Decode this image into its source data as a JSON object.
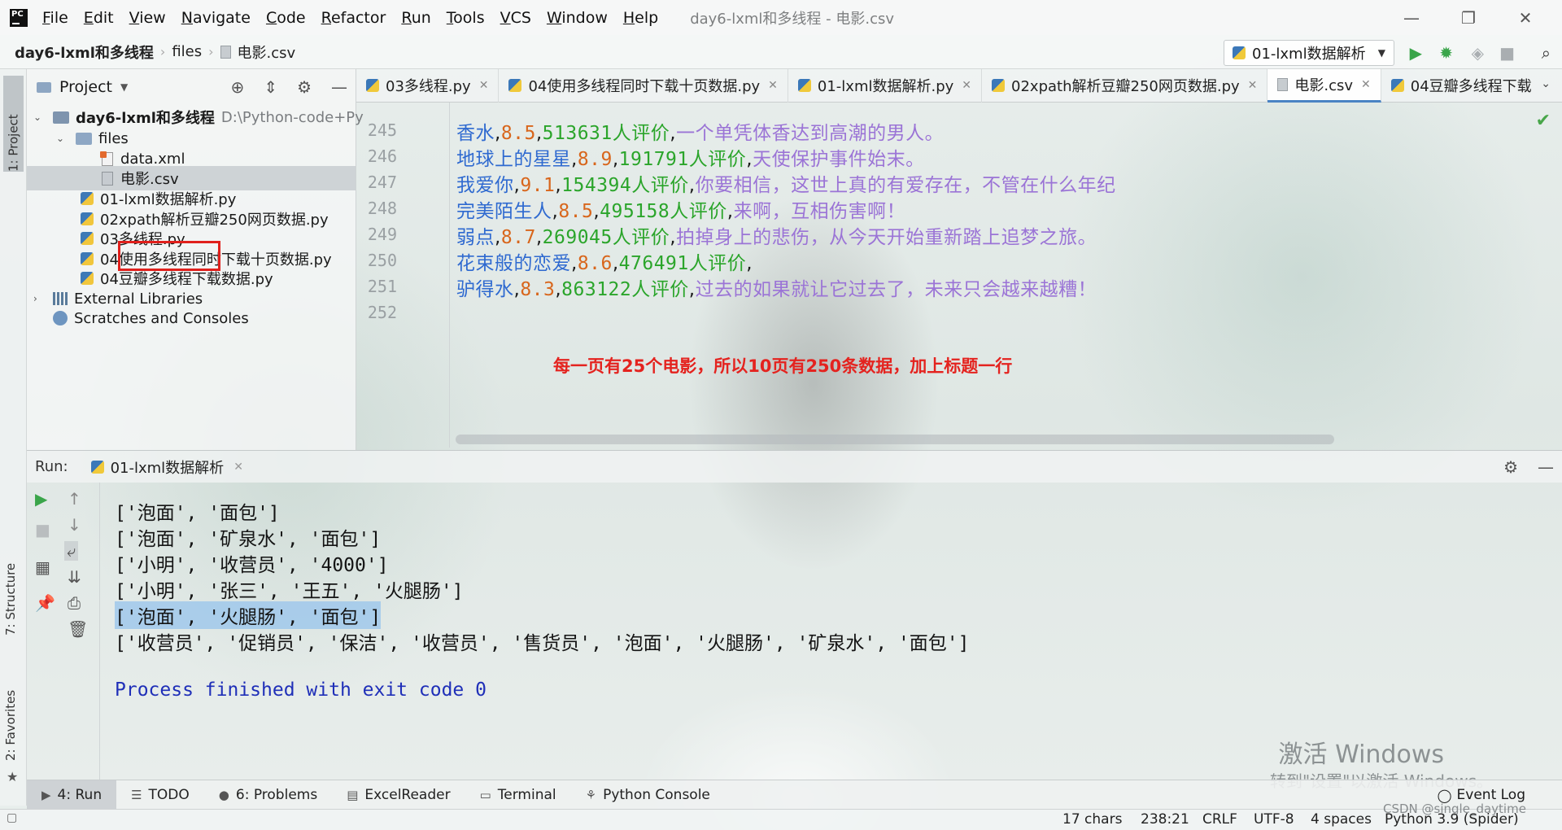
{
  "app": {
    "menu": [
      "File",
      "Edit",
      "View",
      "Navigate",
      "Code",
      "Refactor",
      "Run",
      "Tools",
      "VCS",
      "Window",
      "Help"
    ],
    "window_title": "day6-lxml和多线程 - 电影.csv"
  },
  "nav": {
    "project": "day6-lxml和多线程",
    "folder": "files",
    "file": "电影.csv",
    "run_config": "01-lxml数据解析"
  },
  "left_strip": {
    "project_tab": "1: Project",
    "structure_tab": "7: Structure",
    "favorites_tab": "2: Favorites"
  },
  "project_panel": {
    "title": "Project",
    "root": "day6-lxml和多线程",
    "root_path": "D:\\Python-code+Py",
    "folder": "files",
    "files": [
      "data.xml",
      "电影.csv"
    ],
    "scripts": [
      "01-lxml数据解析.py",
      "02xpath解析豆瓣250网页数据.py",
      "03多线程.py",
      "04使用多线程同时下载十页数据.py",
      "04豆瓣多线程下载数据.py"
    ],
    "external": "External Libraries",
    "scratches": "Scratches and Consoles"
  },
  "editor_tabs": [
    {
      "label": "03多线程.py"
    },
    {
      "label": "04使用多线程同时下载十页数据.py"
    },
    {
      "label": "01-lxml数据解析.py"
    },
    {
      "label": "02xpath解析豆瓣250网页数据.py"
    },
    {
      "label": "电影.csv"
    },
    {
      "label": "04豆瓣多线程下载"
    }
  ],
  "editor": {
    "lines": [
      {
        "n": "245",
        "title": "香水",
        "score": "8.5",
        "count": "513631",
        "quote": "一个单凭体香达到高潮的男人。"
      },
      {
        "n": "246",
        "title": "地球上的星星",
        "score": "8.9",
        "count": "191791",
        "quote": "天使保护事件始末。"
      },
      {
        "n": "247",
        "title": "我爱你",
        "score": "9.1",
        "count": "154394",
        "quote": "你要相信，这世上真的有爱存在，不管在什么年纪"
      },
      {
        "n": "248",
        "title": "完美陌生人",
        "score": "8.5",
        "count": "495158",
        "quote": "来啊，互相伤害啊！"
      },
      {
        "n": "249",
        "title": "弱点",
        "score": "8.7",
        "count": "269045",
        "quote": "拍掉身上的悲伤，从今天开始重新踏上追梦之旅。"
      },
      {
        "n": "250",
        "title": "花束般的恋爱",
        "score": "8.6",
        "count": "476491",
        "quote": ""
      },
      {
        "n": "251",
        "title": "驴得水",
        "score": "8.3",
        "count": "863122",
        "quote": "过去的如果就让它过去了，未来只会越来越糟！"
      }
    ],
    "last_line_number": "252",
    "comma": ",",
    "reviews_suffix": "人评价",
    "annotation": "每一页有25个电影，所以10页有250条数据，加上标题一行"
  },
  "run": {
    "label": "Run:",
    "tab": "01-lxml数据解析",
    "output": [
      "['泡面', '面包']",
      "['泡面', '矿泉水', '面包']",
      "['小明', '收营员', '4000']",
      "['小明', '张三', '王五', '火腿肠']",
      "['泡面', '火腿肠', '面包']",
      "['收营员', '促销员', '保洁', '收营员', '售货员', '泡面', '火腿肠', '矿泉水', '面包']"
    ],
    "process_line": "Process finished with exit code 0",
    "highlighted_index": 4
  },
  "watermark": {
    "line1": "激活 Windows",
    "line2": "转到\"设置\"以激活 Windows。"
  },
  "tool_windows": [
    {
      "label": "4: Run",
      "icon": "play-icon"
    },
    {
      "label": "TODO",
      "icon": "list-icon"
    },
    {
      "label": "6: Problems",
      "icon": "info-icon"
    },
    {
      "label": "ExcelReader",
      "icon": "excel-icon"
    },
    {
      "label": "Terminal",
      "icon": "terminal-icon"
    },
    {
      "label": "Python Console",
      "icon": "python-icon"
    }
  ],
  "event_log": "Event Log",
  "status": {
    "chars": "17 chars",
    "position": "238:21",
    "line_sep": "CRLF",
    "encoding": "UTF-8",
    "indent": "4 spaces",
    "interpreter": "Python 3.9 (Spider)",
    "credit": "CSDN @single_daytime"
  }
}
